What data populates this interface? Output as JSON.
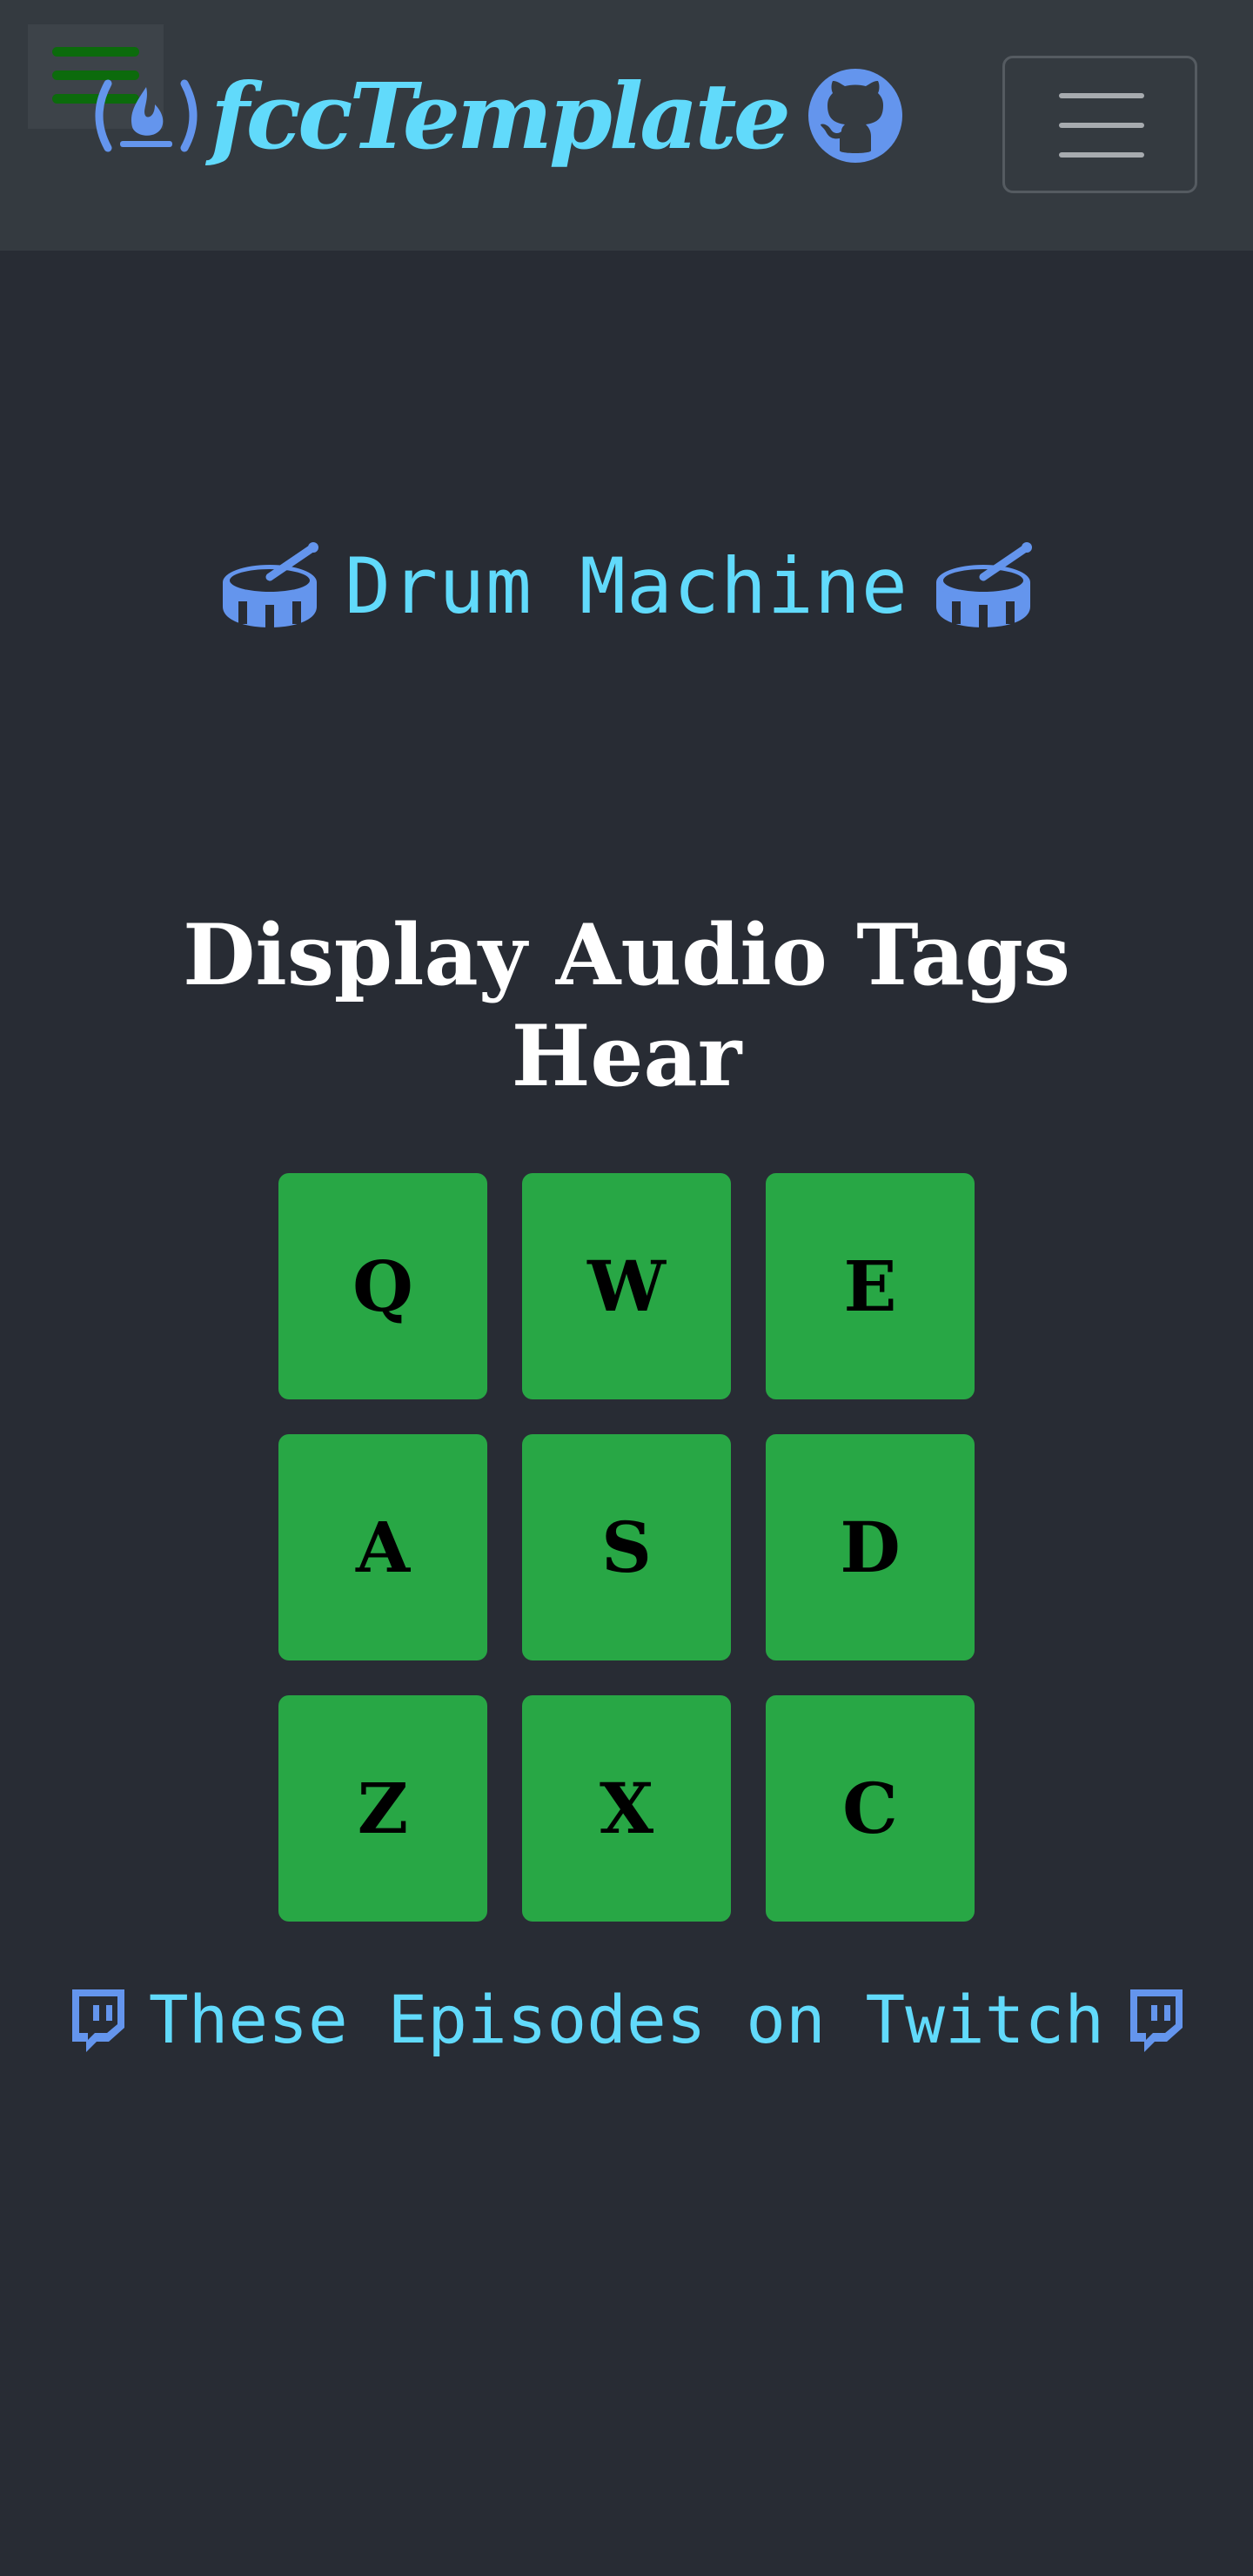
{
  "navbar": {
    "brand_text": "fccTemplate",
    "brand_icon": "free-code-camp-icon",
    "github_icon": "github-icon",
    "menu_icon": "hamburger-icon",
    "toggler_icon": "navbar-toggler-icon"
  },
  "page": {
    "title": "Drum Machine",
    "title_icon": "drum-icon"
  },
  "display": {
    "heading": "Display Audio Tags Hear"
  },
  "pads": [
    "Q",
    "W",
    "E",
    "A",
    "S",
    "D",
    "Z",
    "X",
    "C"
  ],
  "footer": {
    "link_text": "These Episodes on Twitch",
    "icon": "twitch-icon"
  },
  "colors": {
    "background": "#282c34",
    "navbar": "#343a40",
    "accent_cyan": "#61dafb",
    "icon_blue": "#6495ed",
    "pad_green": "#28a745"
  }
}
